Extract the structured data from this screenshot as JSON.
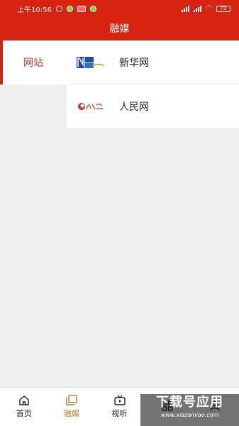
{
  "status": {
    "time": "上午10:56",
    "battery": "73"
  },
  "header": {
    "title": "融媒"
  },
  "sidebar": {
    "items": [
      {
        "label": "网站"
      }
    ]
  },
  "list": {
    "items": [
      {
        "label": "新华网",
        "logo": "xinhua-logo"
      },
      {
        "label": "人民网",
        "logo": "renmin-logo"
      }
    ]
  },
  "tabs": [
    {
      "label": "首页",
      "icon": "home-icon"
    },
    {
      "label": "融媒",
      "icon": "media-icon",
      "active": true
    },
    {
      "label": "视听",
      "icon": "tv-icon"
    },
    {
      "label": "",
      "icon": "grid-icon"
    },
    {
      "label": "",
      "icon": "user-icon"
    }
  ],
  "watermark": {
    "title": "下载号应用",
    "url": "www.xiazainiao.com"
  },
  "colors": {
    "brand_red": "#d7230f",
    "active_tab": "#c77c2a"
  }
}
